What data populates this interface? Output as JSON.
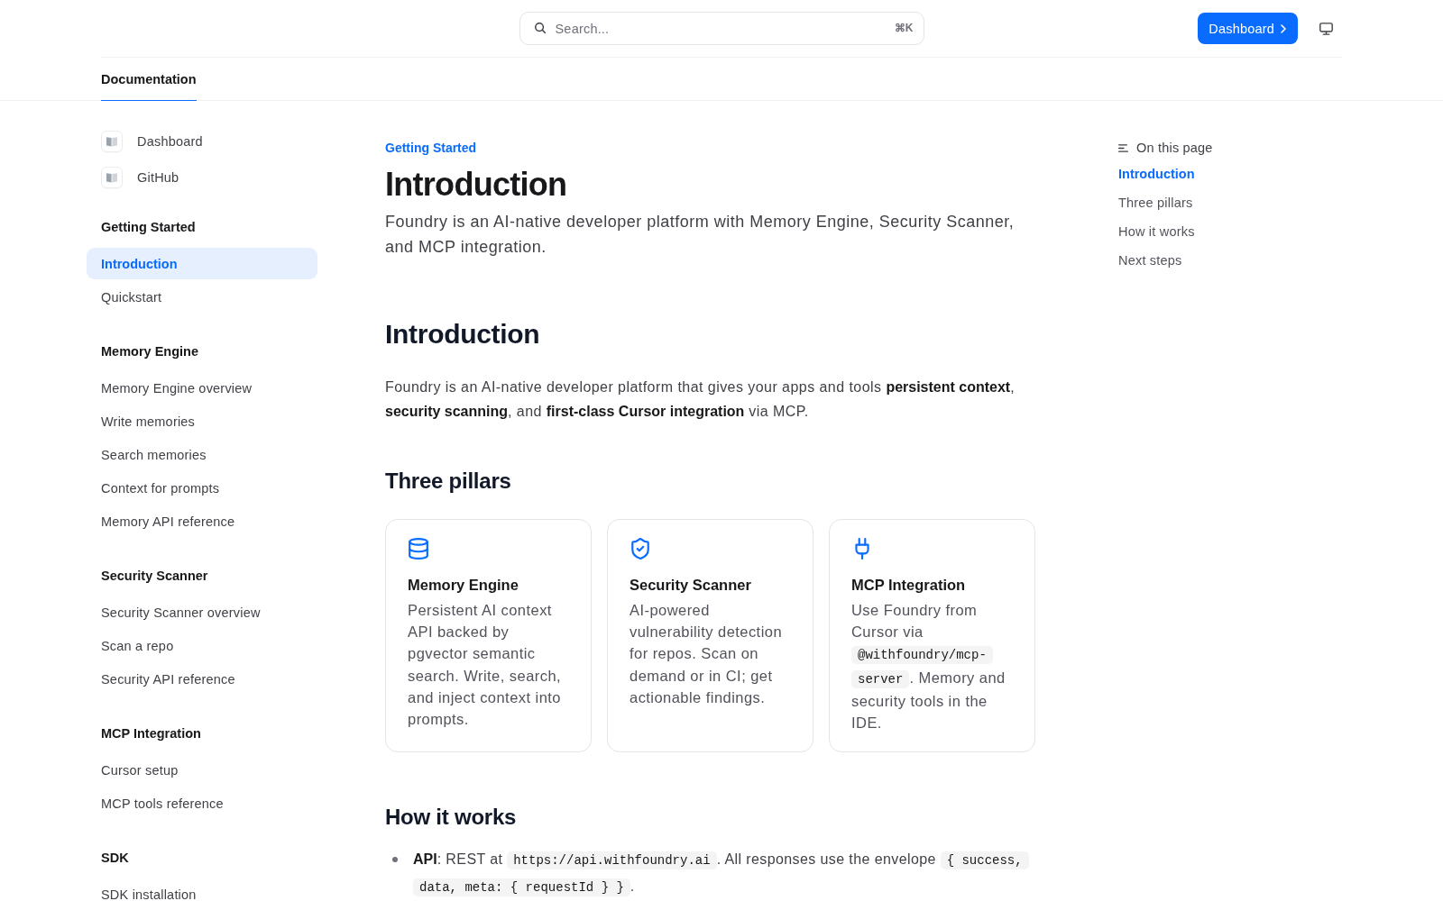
{
  "header": {
    "search": {
      "placeholder": "Search...",
      "shortcut": "⌘K"
    },
    "primary_button": {
      "label": "Dashboard"
    }
  },
  "tabs": [
    {
      "label": "Documentation",
      "selected": true
    }
  ],
  "sidebar": {
    "links": [
      {
        "label": "Dashboard"
      },
      {
        "label": "GitHub"
      }
    ],
    "sections": [
      {
        "title": "Getting Started",
        "items": [
          {
            "label": "Introduction",
            "selected": true
          },
          {
            "label": "Quickstart",
            "selected": false
          }
        ]
      },
      {
        "title": "Memory Engine",
        "items": [
          {
            "label": "Memory Engine overview",
            "selected": false
          },
          {
            "label": "Write memories",
            "selected": false
          },
          {
            "label": "Search memories",
            "selected": false
          },
          {
            "label": "Context for prompts",
            "selected": false
          },
          {
            "label": "Memory API reference",
            "selected": false
          }
        ]
      },
      {
        "title": "Security Scanner",
        "items": [
          {
            "label": "Security Scanner overview",
            "selected": false
          },
          {
            "label": "Scan a repo",
            "selected": false
          },
          {
            "label": "Security API reference",
            "selected": false
          }
        ]
      },
      {
        "title": "MCP Integration",
        "items": [
          {
            "label": "Cursor setup",
            "selected": false
          },
          {
            "label": "MCP tools reference",
            "selected": false
          }
        ]
      },
      {
        "title": "SDK",
        "items": [
          {
            "label": "SDK installation",
            "selected": false
          }
        ]
      }
    ]
  },
  "article": {
    "breadcrumb": "Getting Started",
    "title": "Introduction",
    "lead": "Foundry is an AI-native developer platform with Memory Engine, Security Scanner, and MCP integration.",
    "body_title": "Introduction",
    "body_intro": "Foundry is an AI-native developer platform that gives your apps and tools **persistent context**, **security scanning**, and **first-class Cursor integration** via MCP.",
    "sections": [
      {
        "kind": "cards",
        "heading": "Three pillars",
        "cards": [
          {
            "title": "Memory Engine",
            "description": [
              {
                "kind": "text",
                "text": "Persistent AI context API backed by pgvector semantic search. Write, search, and inject context into prompts."
              }
            ]
          },
          {
            "title": "Security Scanner",
            "description": [
              {
                "kind": "text",
                "text": "AI-powered vulnerability detection for repos. Scan on demand or in CI; get actionable findings."
              }
            ]
          },
          {
            "title": "MCP Integration",
            "description": [
              {
                "kind": "text",
                "text": "Use Foundry from Cursor via "
              },
              {
                "kind": "code",
                "text": "@withfoundry/mcp-server"
              },
              {
                "kind": "text",
                "text": ". Memory and security tools in the IDE."
              }
            ]
          }
        ]
      },
      {
        "kind": "list",
        "heading": "How it works",
        "items": [
          {
            "parts": [
              {
                "kind": "text",
                "text": "**API**: REST at "
              },
              {
                "kind": "code",
                "text": "https://api.withfoundry.ai"
              },
              {
                "kind": "text",
                "text": ". All responses use the envelope "
              },
              {
                "kind": "code",
                "text": "{ success, data, meta: { requestId } }"
              },
              {
                "kind": "text",
                "text": "."
              }
            ]
          }
        ]
      }
    ]
  },
  "toc": {
    "title": "On this page",
    "items": [
      {
        "label": "Introduction",
        "selected": true
      },
      {
        "label": "Three pillars",
        "selected": false
      },
      {
        "label": "How it works",
        "selected": false
      },
      {
        "label": "Next steps",
        "selected": false
      }
    ]
  }
}
